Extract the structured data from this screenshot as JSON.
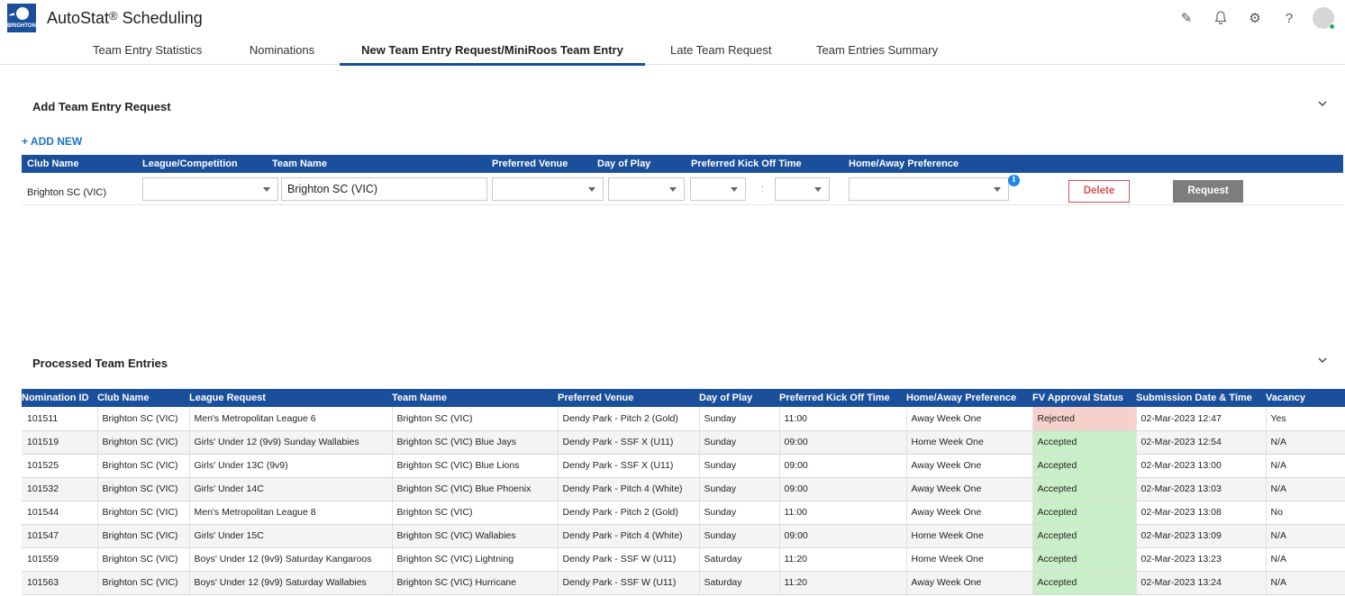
{
  "app": {
    "title": "AutoStat",
    "registered": "®",
    "subtitle": "Scheduling",
    "logo_text": "BRIGHTON"
  },
  "header_icons": [
    "edit-icon",
    "bell-icon",
    "gear-icon",
    "help-icon",
    "user-avatar"
  ],
  "header_icon_glyphs": {
    "edit": "✎",
    "bell": "🔔",
    "gear": "⚙",
    "help": "?"
  },
  "tabs": [
    {
      "label": "Team Entry Statistics"
    },
    {
      "label": "Nominations"
    },
    {
      "label": "New Team Entry Request/MiniRoos Team Entry",
      "active": true
    },
    {
      "label": "Late Team Request"
    },
    {
      "label": "Team Entries Summary"
    }
  ],
  "add_section": {
    "title": "Add Team Entry Request",
    "add_new": "+ ADD NEW",
    "columns": [
      "Club Name",
      "League/Competition",
      "Team Name",
      "Preferred Venue",
      "Day of Play",
      "Preferred Kick Off Time",
      "Home/Away Preference"
    ],
    "row": {
      "club_name": "Brighton SC (VIC)",
      "team_name": "Brighton SC (VIC)",
      "time_separator": ":",
      "info_glyph": "i",
      "delete_label": "Delete",
      "request_label": "Request"
    }
  },
  "processed_section": {
    "title": "Processed Team Entries",
    "columns": [
      "Nomination ID",
      "Club Name",
      "League Request",
      "Team Name",
      "Preferred Venue",
      "Day of Play",
      "Preferred Kick Off Time",
      "Home/Away Preference",
      "FV Approval Status",
      "Submission Date & Time",
      "Vacancy"
    ],
    "rows": [
      [
        "101511",
        "Brighton SC (VIC)",
        "Men's Metropolitan League 6",
        "Brighton SC (VIC)",
        "Dendy Park - Pitch 2 (Gold)",
        "Sunday",
        "11:00",
        "Away Week One",
        "Rejected",
        "02-Mar-2023 12:47",
        "Yes"
      ],
      [
        "101519",
        "Brighton SC (VIC)",
        "Girls' Under 12 (9v9) Sunday Wallabies",
        "Brighton SC (VIC) Blue Jays",
        "Dendy Park - SSF X (U11)",
        "Sunday",
        "09:00",
        "Home Week One",
        "Accepted",
        "02-Mar-2023 12:54",
        "N/A"
      ],
      [
        "101525",
        "Brighton SC (VIC)",
        "Girls' Under 13C (9v9)",
        "Brighton SC (VIC) Blue Lions",
        "Dendy Park - SSF X (U11)",
        "Sunday",
        "09:00",
        "Away Week One",
        "Accepted",
        "02-Mar-2023 13:00",
        "N/A"
      ],
      [
        "101532",
        "Brighton SC (VIC)",
        "Girls' Under 14C",
        "Brighton SC (VIC) Blue Phoenix",
        "Dendy Park - Pitch 4 (White)",
        "Sunday",
        "09:00",
        "Away Week One",
        "Accepted",
        "02-Mar-2023 13:03",
        "N/A"
      ],
      [
        "101544",
        "Brighton SC (VIC)",
        "Men's Metropolitan League 8",
        "Brighton SC (VIC)",
        "Dendy Park - Pitch 2 (Gold)",
        "Sunday",
        "11:00",
        "Away Week One",
        "Accepted",
        "02-Mar-2023 13:08",
        "No"
      ],
      [
        "101547",
        "Brighton SC (VIC)",
        "Girls' Under 15C",
        "Brighton SC (VIC) Wallabies",
        "Dendy Park - Pitch 4 (White)",
        "Sunday",
        "09:00",
        "Home Week One",
        "Accepted",
        "02-Mar-2023 13:09",
        "N/A"
      ],
      [
        "101559",
        "Brighton SC (VIC)",
        "Boys' Under 12 (9v9) Saturday Kangaroos",
        "Brighton SC (VIC) Lightning",
        "Dendy Park - SSF W (U11)",
        "Saturday",
        "11:20",
        "Home Week One",
        "Accepted",
        "02-Mar-2023 13:23",
        "N/A"
      ],
      [
        "101563",
        "Brighton SC (VIC)",
        "Boys' Under 12 (9v9) Saturday Wallabies",
        "Brighton SC (VIC) Hurricane",
        "Dendy Park - SSF W (U11)",
        "Saturday",
        "11:20",
        "Away Week One",
        "Accepted",
        "02-Mar-2023 13:24",
        "N/A"
      ]
    ]
  },
  "colors": {
    "brand": "#1a4f9c",
    "accepted": "#c9efc9",
    "rejected": "#f6d1cc",
    "link": "#1a73c8",
    "delete": "#d9534f"
  }
}
